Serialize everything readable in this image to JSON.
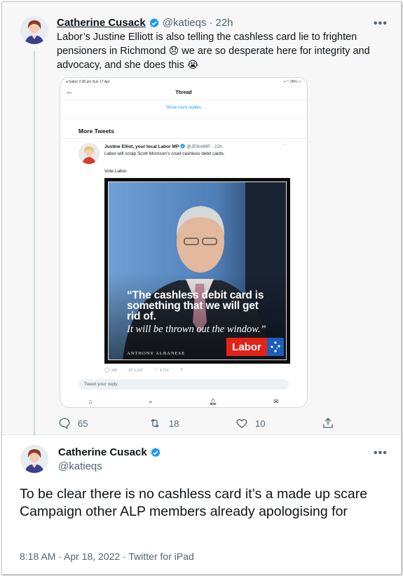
{
  "tweet1": {
    "display_name": "Catherine Cusack",
    "handle": "@katieqs",
    "time": "22h",
    "text_part1": "Labor’s Justine Elliott is also telling the cashless card lie to frighten pensioners in Richmond ",
    "emoji_1": "😞",
    "text_part2": " we are so desperate here for integrity and advocacy, and she does this ",
    "emoji_2": "😭",
    "more_label": "•••",
    "actions": {
      "replies": "65",
      "retweets": "18",
      "likes": "10"
    }
  },
  "embedded_screenshot": {
    "status_left": "◂ Safari  2:38 pm  Sun 17 Apr",
    "status_right": "26%",
    "nav_title": "Thread",
    "show_more": "Show more replies",
    "section_heading": "More Tweets",
    "inner_tweet": {
      "display_name": "Justine Elliot, your local Labor MP",
      "handle": "@JElliotMP",
      "time": "22h",
      "text": "Labor will scrap Scott Morrison’s cruel cashless debit cards.",
      "vote_line": "Vote Labor.",
      "poster_quote_bold": "“The cashless debit card is something that we will get rid of.",
      "poster_quote_serif": "It will be thrown out the window.”",
      "poster_attribution": "ANTHONY ALBANESE",
      "poster_logo": "Labor",
      "stats": {
        "replies": "295",
        "retweets": "1,333",
        "likes": "4,710"
      }
    },
    "reply_placeholder": "Tweet your reply"
  },
  "tweet2": {
    "display_name": "Catherine Cusack",
    "handle": "@katieqs",
    "more_label": "•••",
    "text": "To be clear there is no cashless card it’s a made up scare Campaign other ALP members already apologising for",
    "meta": "8:18 AM · Apr 18, 2022 · Twitter for iPad"
  },
  "colors": {
    "verified_blue": "#1d9bf0",
    "labor_red": "#e2231a",
    "text_secondary": "#536471"
  }
}
